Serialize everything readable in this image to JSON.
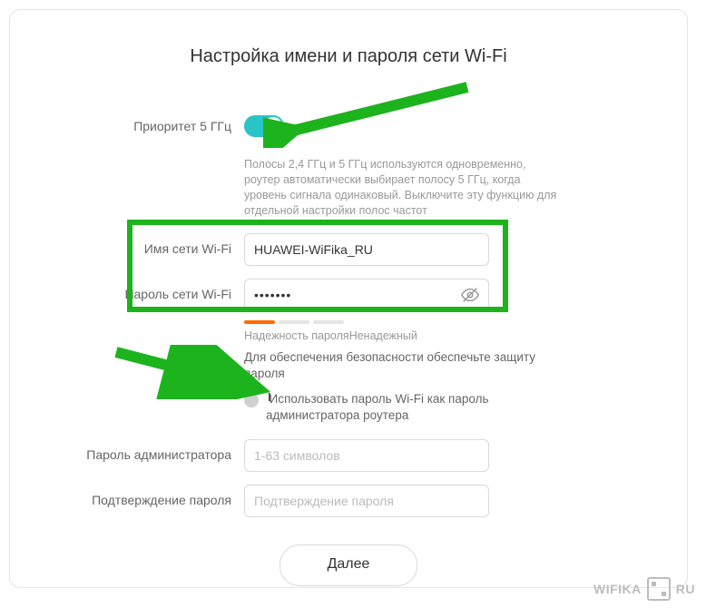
{
  "title": "Настройка имени и пароля сети Wi-Fi",
  "priority5": {
    "label": "Приоритет 5 ГГц",
    "on": true,
    "helper": "Полосы 2,4 ГГц и 5 ГГц используются одновременно, роутер автоматически выбирает полосу 5 ГГц, когда уровень сигнала одинаковый. Выключите эту функцию для отдельной настройки полос частот"
  },
  "ssid": {
    "label": "Имя сети Wi-Fi",
    "value": "HUAWEI-WiFika_RU"
  },
  "password": {
    "label": "Пароль сети Wi-Fi",
    "value": "•••••••",
    "strength_title": "Надежность пароля",
    "strength_value": "Ненадежный",
    "security_tip": "Для обеспечения безопасности обеспечьте защиту пароля"
  },
  "reuse_check": {
    "label": "Использовать пароль Wi-Fi как пароль администратора роутера",
    "checked": false
  },
  "admin_pw": {
    "label": "Пароль администратора",
    "placeholder": "1-63 символов"
  },
  "admin_pw_confirm": {
    "label": "Подтверждение пароля",
    "placeholder": "Подтверждение пароля"
  },
  "next_button": "Далее",
  "watermark": {
    "left": "WIFIKA",
    "right": "RU"
  }
}
